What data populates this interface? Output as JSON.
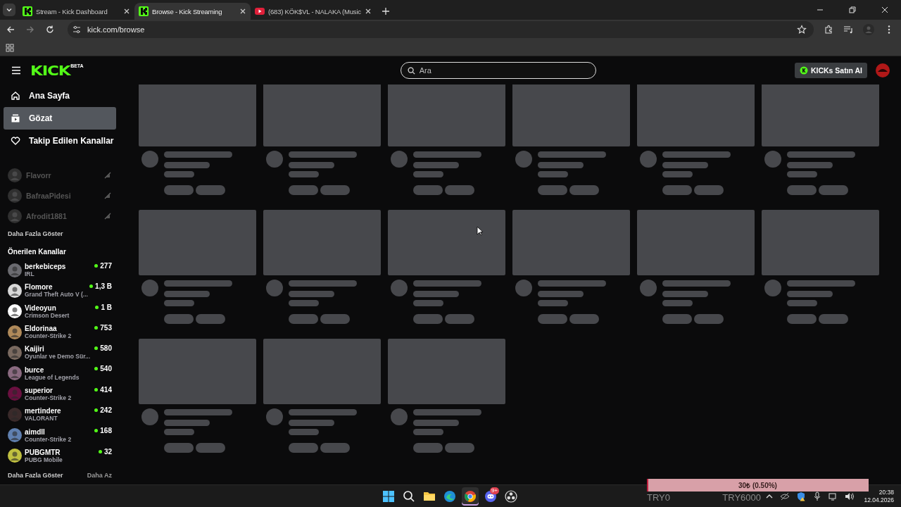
{
  "browser": {
    "tabs": [
      {
        "title": "Stream - Kick Dashboard",
        "selected": false,
        "kind": "kick"
      },
      {
        "title": "Browse - Kick Streaming",
        "selected": true,
        "kind": "kick"
      },
      {
        "title": "(683) KÖK$VL - NALAKA (Music",
        "selected": false,
        "kind": "youtube"
      }
    ],
    "url": "kick.com/browse"
  },
  "header": {
    "logo": "KICK",
    "logo_badge": "BETA",
    "search_placeholder": "Ara",
    "buy_button": "KICKs Satın Al"
  },
  "nav": [
    {
      "label": "Ana Sayfa",
      "kind": "home",
      "selected": false
    },
    {
      "label": "Gözat",
      "kind": "browse",
      "selected": true
    },
    {
      "label": "Takip Edilen Kanallar",
      "kind": "heart",
      "selected": false
    }
  ],
  "followed": [
    {
      "name": "Flavorr",
      "live": false
    },
    {
      "name": "BafraaPidesi",
      "live": false
    },
    {
      "name": "Afrodit1881",
      "live": false
    }
  ],
  "followed_more": "Daha Fazla Göster",
  "recommended": {
    "title": "Önerilen Kanallar",
    "channels": [
      {
        "name": "berkebiceps",
        "category": "IRL",
        "viewers": "277"
      },
      {
        "name": "Flomore",
        "category": "Grand Theft Auto V (...",
        "viewers": "1,3 B"
      },
      {
        "name": "Videoyun",
        "category": "Crimson Desert",
        "viewers": "1 B"
      },
      {
        "name": "Eldorinaa",
        "category": "Counter-Strike 2",
        "viewers": "753"
      },
      {
        "name": "Kaijiri",
        "category": "Oyunlar ve Demo Sür...",
        "viewers": "580"
      },
      {
        "name": "burce",
        "category": "League of Legends",
        "viewers": "540"
      },
      {
        "name": "superior",
        "category": "Counter-Strike 2",
        "viewers": "414"
      },
      {
        "name": "mertindere",
        "category": "VALORANT",
        "viewers": "242"
      },
      {
        "name": "aimdll",
        "category": "Counter-Strike 2",
        "viewers": "168"
      },
      {
        "name": "PUBGMTR",
        "category": "PUBG Mobile",
        "viewers": "32"
      }
    ],
    "more": "Daha Fazla Göster",
    "less": "Daha Az"
  },
  "cards": [
    {
      "kind": "skeleton"
    },
    {
      "kind": "skeleton"
    },
    {
      "kind": "skeleton"
    },
    {
      "kind": "skeleton"
    },
    {
      "kind": "skeleton"
    },
    {
      "kind": "skeleton"
    },
    {
      "kind": "skeleton"
    },
    {
      "kind": "skeleton"
    },
    {
      "kind": "skeleton"
    },
    {
      "kind": "skeleton"
    },
    {
      "kind": "skeleton"
    },
    {
      "kind": "skeleton"
    },
    {
      "kind": "skeleton"
    },
    {
      "kind": "skeleton"
    },
    {
      "kind": "skeleton"
    }
  ],
  "taskbar": {
    "apps": [
      {
        "kind": "windows",
        "selected": false
      },
      {
        "kind": "search",
        "selected": false
      },
      {
        "kind": "folder",
        "selected": false
      },
      {
        "kind": "edge",
        "selected": false
      },
      {
        "kind": "chrome",
        "selected": true
      },
      {
        "kind": "discord",
        "selected": false,
        "badge": "9+"
      },
      {
        "kind": "obs",
        "selected": false
      }
    ],
    "time": "20:38",
    "date": "12.04.2026"
  },
  "donation_overlay": {
    "label": "30₺ (0.50%)",
    "level": 0.005,
    "min": "TRY0",
    "max": "TRY6000"
  }
}
